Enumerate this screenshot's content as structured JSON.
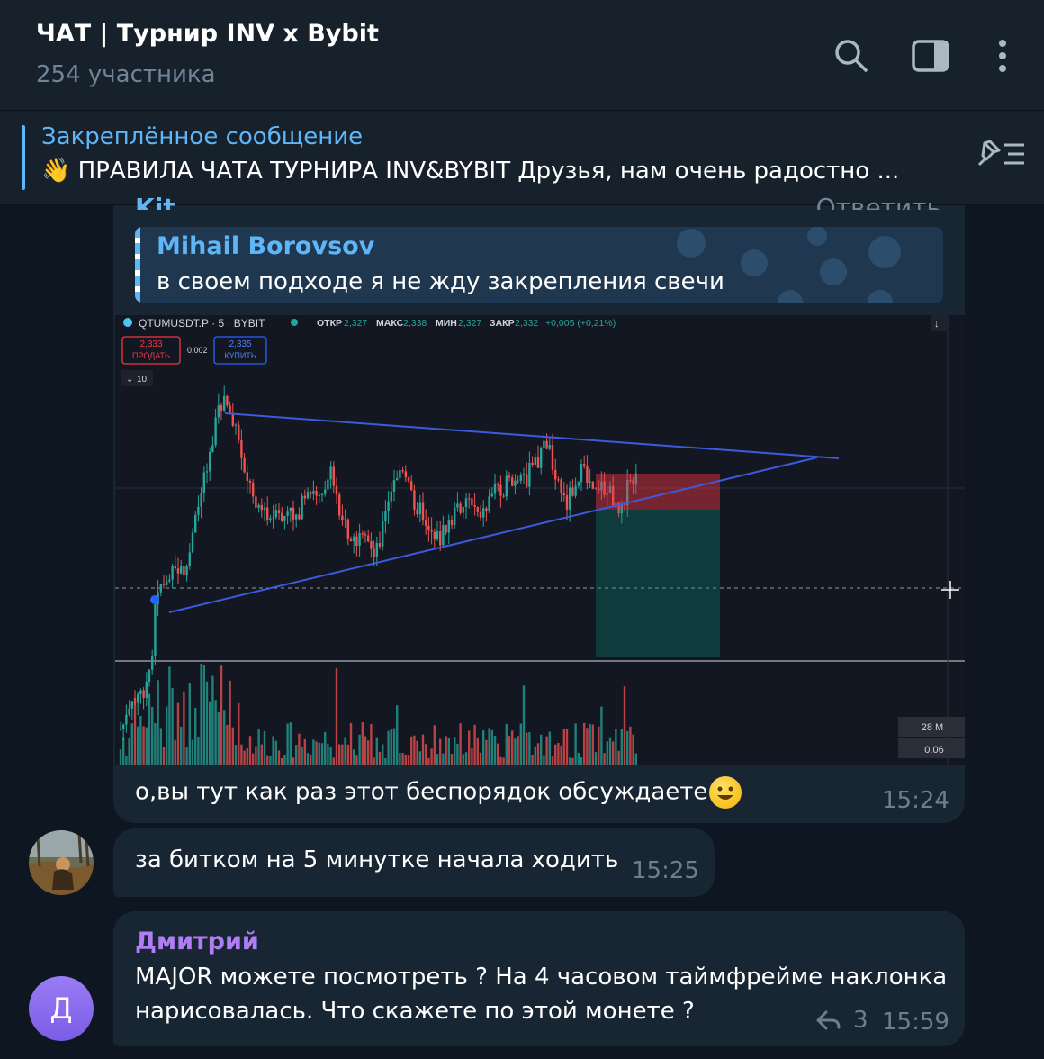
{
  "header": {
    "title": "ЧАТ | Турнир INV x Bybit",
    "subtitle": "254 участника"
  },
  "pinned": {
    "title": "Закреплённое сообщение",
    "emoji": "👋",
    "text": "ПРАВИЛА ЧАТА ТУРНИРА INV&BYBIT  Друзья, нам очень радостно ..."
  },
  "message1": {
    "cut_sender": "Kit",
    "cut_action": "Ответить",
    "reply": {
      "name": "Mihail Borovsov",
      "text": "в своем подходе я не жду закрепления свечи"
    },
    "chart": {
      "symbol": "QTUMUSDT.P · 5 · BYBIT",
      "ohlc": {
        "open_label": "ОТКР",
        "open": "2,327",
        "high_label": "МАКС",
        "high": "2,338",
        "low_label": "МИН",
        "low": "2,327",
        "close_label": "ЗАКР",
        "close": "2,332",
        "change": "+0,005 (+0,21%)"
      },
      "sell_price": "2,333",
      "sell_label": "ПРОДАТЬ",
      "spread": "0,002",
      "buy_price": "2,335",
      "buy_label": "КУПИТЬ",
      "indicator_count": "10",
      "vol_label": "28 M",
      "vol_value": "0.06"
    },
    "text": "о,вы тут как раз этот беспорядок обсуждаете",
    "time": "15:24"
  },
  "message2": {
    "text": "за битком на 5 минутке начала ходить",
    "time": "15:25"
  },
  "message3": {
    "avatar_letter": "Д",
    "sender": "Дмитрий",
    "line1": "MAJOR можете посмотреть ? На 4 часовом таймфрейме наклонка",
    "line2": "нарисовалась. Что скажете по этой монете ?",
    "replies": "3",
    "time": "15:59"
  },
  "colors": {
    "bg": "#0e1621",
    "bubble": "#182533",
    "accent": "#5eb5f7",
    "sender_purple": "#b07df3",
    "candle_up": "#26a69a",
    "candle_down": "#ef5350",
    "trendline": "#3b5bdb"
  }
}
